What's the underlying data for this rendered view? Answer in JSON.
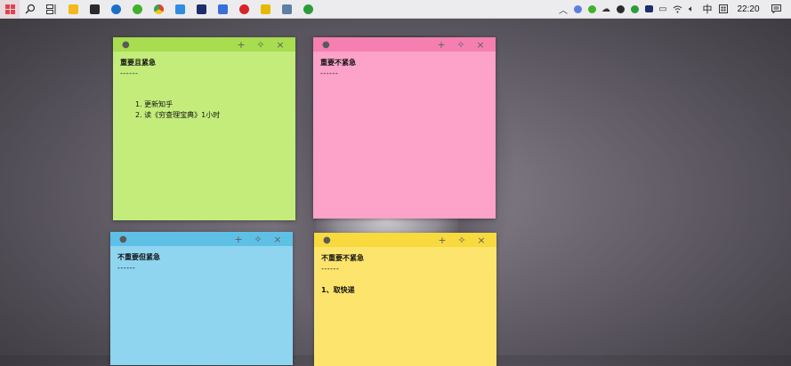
{
  "taskbar": {
    "clock": "22:20",
    "ime_label": "中",
    "apps": [
      {
        "name": "file-explorer",
        "color": "#f2b91d",
        "shape": "sq"
      },
      {
        "name": "store",
        "color": "#2b2b2b",
        "shape": "sq"
      },
      {
        "name": "browser-blue",
        "color": "#1b6fc7",
        "shape": "circ"
      },
      {
        "name": "wechat",
        "color": "#43b02a",
        "shape": "circ"
      },
      {
        "name": "chrome",
        "color": "#e44134",
        "shape": "circ"
      },
      {
        "name": "app-blue",
        "color": "#2f8ce0",
        "shape": "sq"
      },
      {
        "name": "app-navy",
        "color": "#1d2e6b",
        "shape": "sq"
      },
      {
        "name": "app-check",
        "color": "#3a6fd8",
        "shape": "sq"
      },
      {
        "name": "netease-music",
        "color": "#d8232a",
        "shape": "circ"
      },
      {
        "name": "app-yellow",
        "color": "#e6b800",
        "shape": "sq"
      },
      {
        "name": "notes",
        "color": "#5c7fa3",
        "shape": "sq"
      },
      {
        "name": "app-green",
        "color": "#2a9d3a",
        "shape": "circ"
      }
    ],
    "tray_icons": [
      "chevron-up-icon",
      "app-tray-icon",
      "wechat-tray-icon",
      "cloud-icon",
      "music-tray-icon",
      "green-tray-icon",
      "monitor-icon",
      "folder-icon",
      "wifi-icon",
      "volume-icon"
    ]
  },
  "notes": {
    "green": {
      "title": "重要且紧急",
      "separator": "------",
      "items": [
        "1.  更新知乎",
        "2.  读《穷查理宝典》1小时"
      ]
    },
    "pink": {
      "title": "重要不紧急",
      "separator": "------"
    },
    "blue": {
      "title": "不重要但紧急",
      "separator": "------"
    },
    "yellow": {
      "title": "不重要不紧急",
      "separator": "------",
      "line": "1、取快递"
    }
  },
  "colors": {
    "green_body": "#c3ec7a",
    "pink_body": "#fda2c8",
    "blue_body": "#8fd5f0",
    "yellow_body": "#fde46d"
  }
}
